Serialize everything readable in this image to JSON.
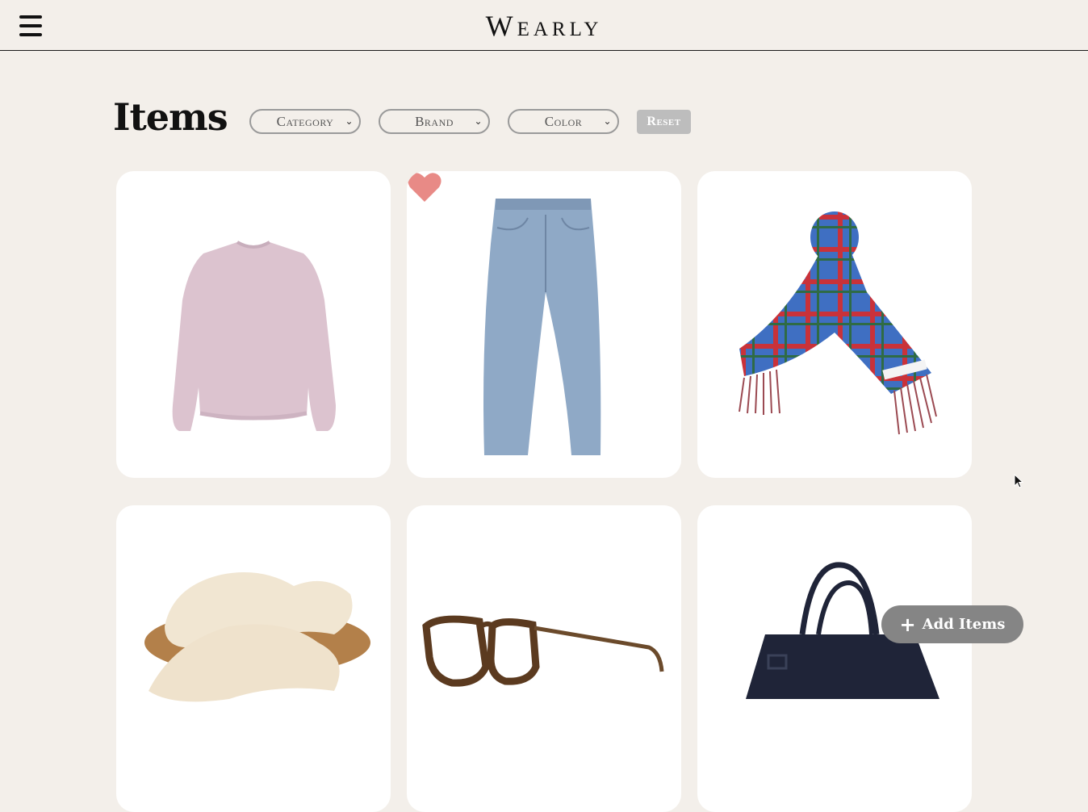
{
  "header": {
    "menu_icon": "hamburger-menu-icon",
    "brand": "Wearly"
  },
  "main": {
    "title": "Items",
    "filters": {
      "category": "Category",
      "brand": "Brand",
      "color": "Color",
      "reset": "Reset"
    }
  },
  "items": [
    {
      "kind": "sweatshirt",
      "color": "#dcc3cf",
      "favorite": false
    },
    {
      "kind": "jeans",
      "color": "#8fa9c6",
      "favorite": true
    },
    {
      "kind": "plaid-scarf",
      "color": "#3f6fc2",
      "favorite": false
    },
    {
      "kind": "shearling-sandals",
      "color": "#f1e6d2",
      "favorite": false
    },
    {
      "kind": "tortoiseshell-glasses",
      "color": "#5b3a1f",
      "favorite": false
    },
    {
      "kind": "tote-bag",
      "color": "#1f2438",
      "favorite": false
    }
  ],
  "fab": {
    "label": "Add Items",
    "icon": "plus-icon"
  },
  "colors": {
    "background": "#f3efea",
    "heart": "#e88a86",
    "fab": "#858585",
    "reset": "#bdbdbd"
  }
}
